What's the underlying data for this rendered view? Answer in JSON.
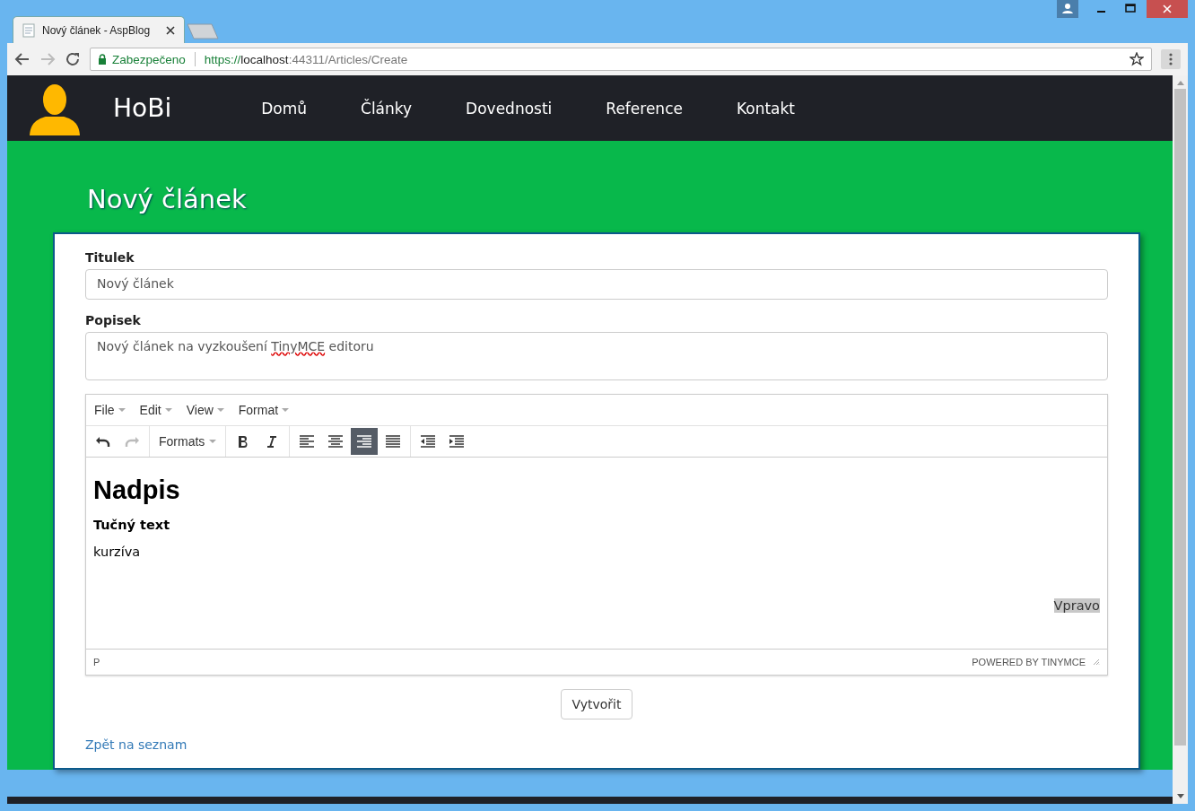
{
  "browser": {
    "tab_title": "Nový článek - AspBlog",
    "secure_label": "Zabezpečeno",
    "url_scheme": "https://",
    "url_host": "localhost",
    "url_rest": ":44311/Articles/Create"
  },
  "nav": {
    "brand": "HoBi",
    "items": [
      {
        "label": "Domů"
      },
      {
        "label": "Články"
      },
      {
        "label": "Dovednosti"
      },
      {
        "label": "Reference"
      },
      {
        "label": "Kontakt"
      }
    ]
  },
  "page_title": "Nový článek",
  "title_field": {
    "label": "Titulek",
    "value": "Nový článek"
  },
  "description_field": {
    "label": "Popisek",
    "value_before": "Nový článek na vyzkoušení ",
    "value_misspelled": "TinyMCE",
    "value_after": " editoru"
  },
  "editor": {
    "menu": [
      {
        "label": "File"
      },
      {
        "label": "Edit"
      },
      {
        "label": "View"
      },
      {
        "label": "Format"
      }
    ],
    "toolbar": [
      [
        {
          "kind": "undo",
          "disabled": false
        },
        {
          "kind": "redo",
          "disabled": true
        }
      ],
      [
        {
          "kind": "formats",
          "label": "Formats"
        }
      ],
      [
        {
          "kind": "bold",
          "selected": false
        },
        {
          "kind": "italic",
          "selected": false
        }
      ],
      [
        {
          "kind": "align-left",
          "selected": false
        },
        {
          "kind": "align-center",
          "selected": false
        },
        {
          "kind": "align-right",
          "selected": true
        },
        {
          "kind": "align-justify",
          "selected": false
        }
      ],
      [
        {
          "kind": "outdent"
        },
        {
          "kind": "indent"
        }
      ]
    ],
    "content": [
      {
        "kind": "heading",
        "text": "Nadpis"
      },
      {
        "kind": "bold",
        "text": "Tučný text"
      },
      {
        "kind": "paragraph",
        "text": "kurzíva"
      },
      {
        "kind": "empty"
      },
      {
        "kind": "right",
        "text": "Vpravo",
        "highlighted": true
      }
    ],
    "path": "P",
    "branding": "POWERED BY TINYMCE"
  },
  "submit_button": "Vytvořit",
  "back_link": "Zpět na seznam"
}
